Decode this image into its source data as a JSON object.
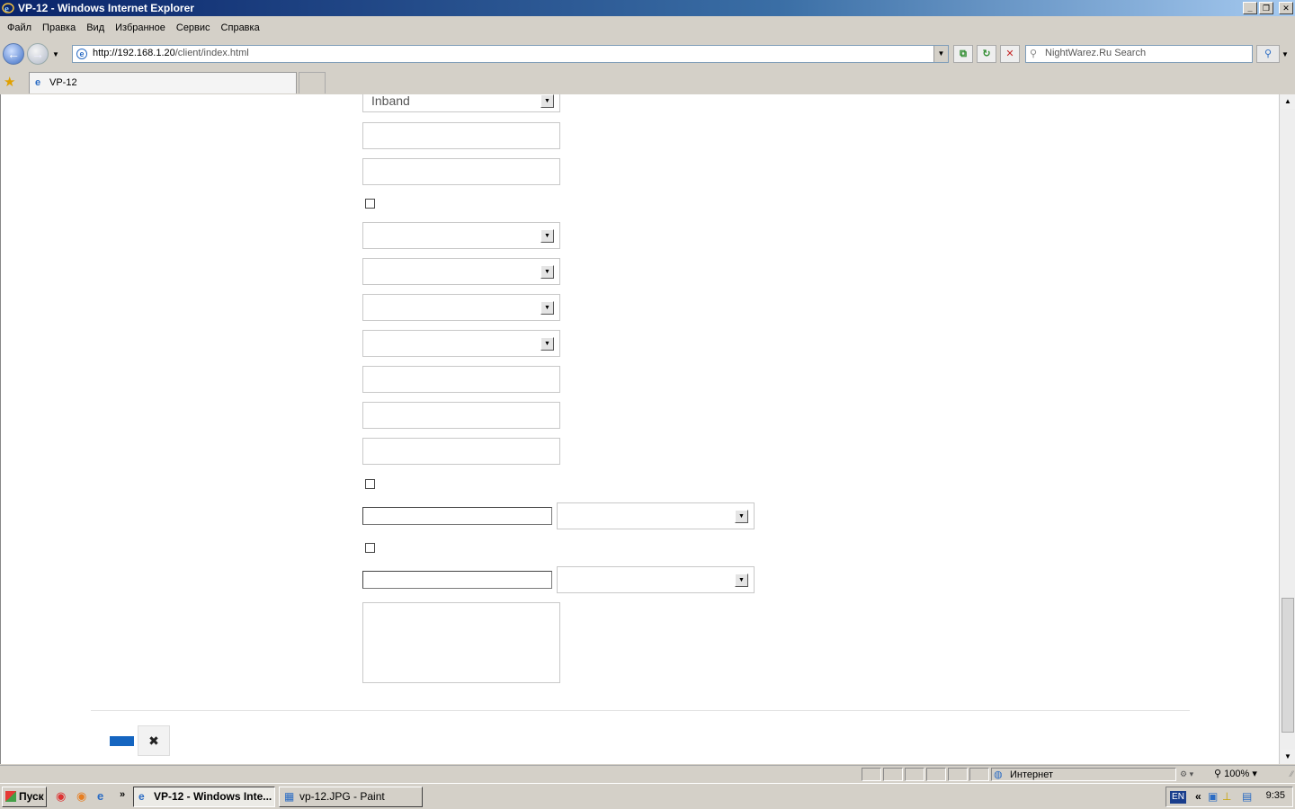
{
  "window": {
    "title": "VP-12 - Windows Internet Explorer",
    "buttons": {
      "minimize": "_",
      "maximize": "❐",
      "close": "✕"
    }
  },
  "menu": [
    "Файл",
    "Правка",
    "Вид",
    "Избранное",
    "Сервис",
    "Справка"
  ],
  "address": {
    "host": "http://192.168.1.20",
    "path": "/client/index.html"
  },
  "search": {
    "placeholder": "NightWarez.Ru Search"
  },
  "tab": {
    "label": "VP-12"
  },
  "form": {
    "mode_select_value": "Inband",
    "cancel_label": "✖"
  },
  "status": {
    "zone": "Интернет",
    "zoom": "100%"
  },
  "taskbar": {
    "start": "Пуск",
    "items": [
      "VP-12 - Windows Inte...",
      "vp-12.JPG - Paint"
    ],
    "lang": "EN",
    "clock": "9:35"
  },
  "icons": {
    "app": "ie-icon",
    "favorites": "star-icon",
    "back": "back-arrow-icon",
    "forward": "forward-arrow-icon",
    "refresh": "refresh-icon",
    "stop": "stop-icon",
    "search": "magnifier-icon",
    "zone": "globe-icon"
  }
}
